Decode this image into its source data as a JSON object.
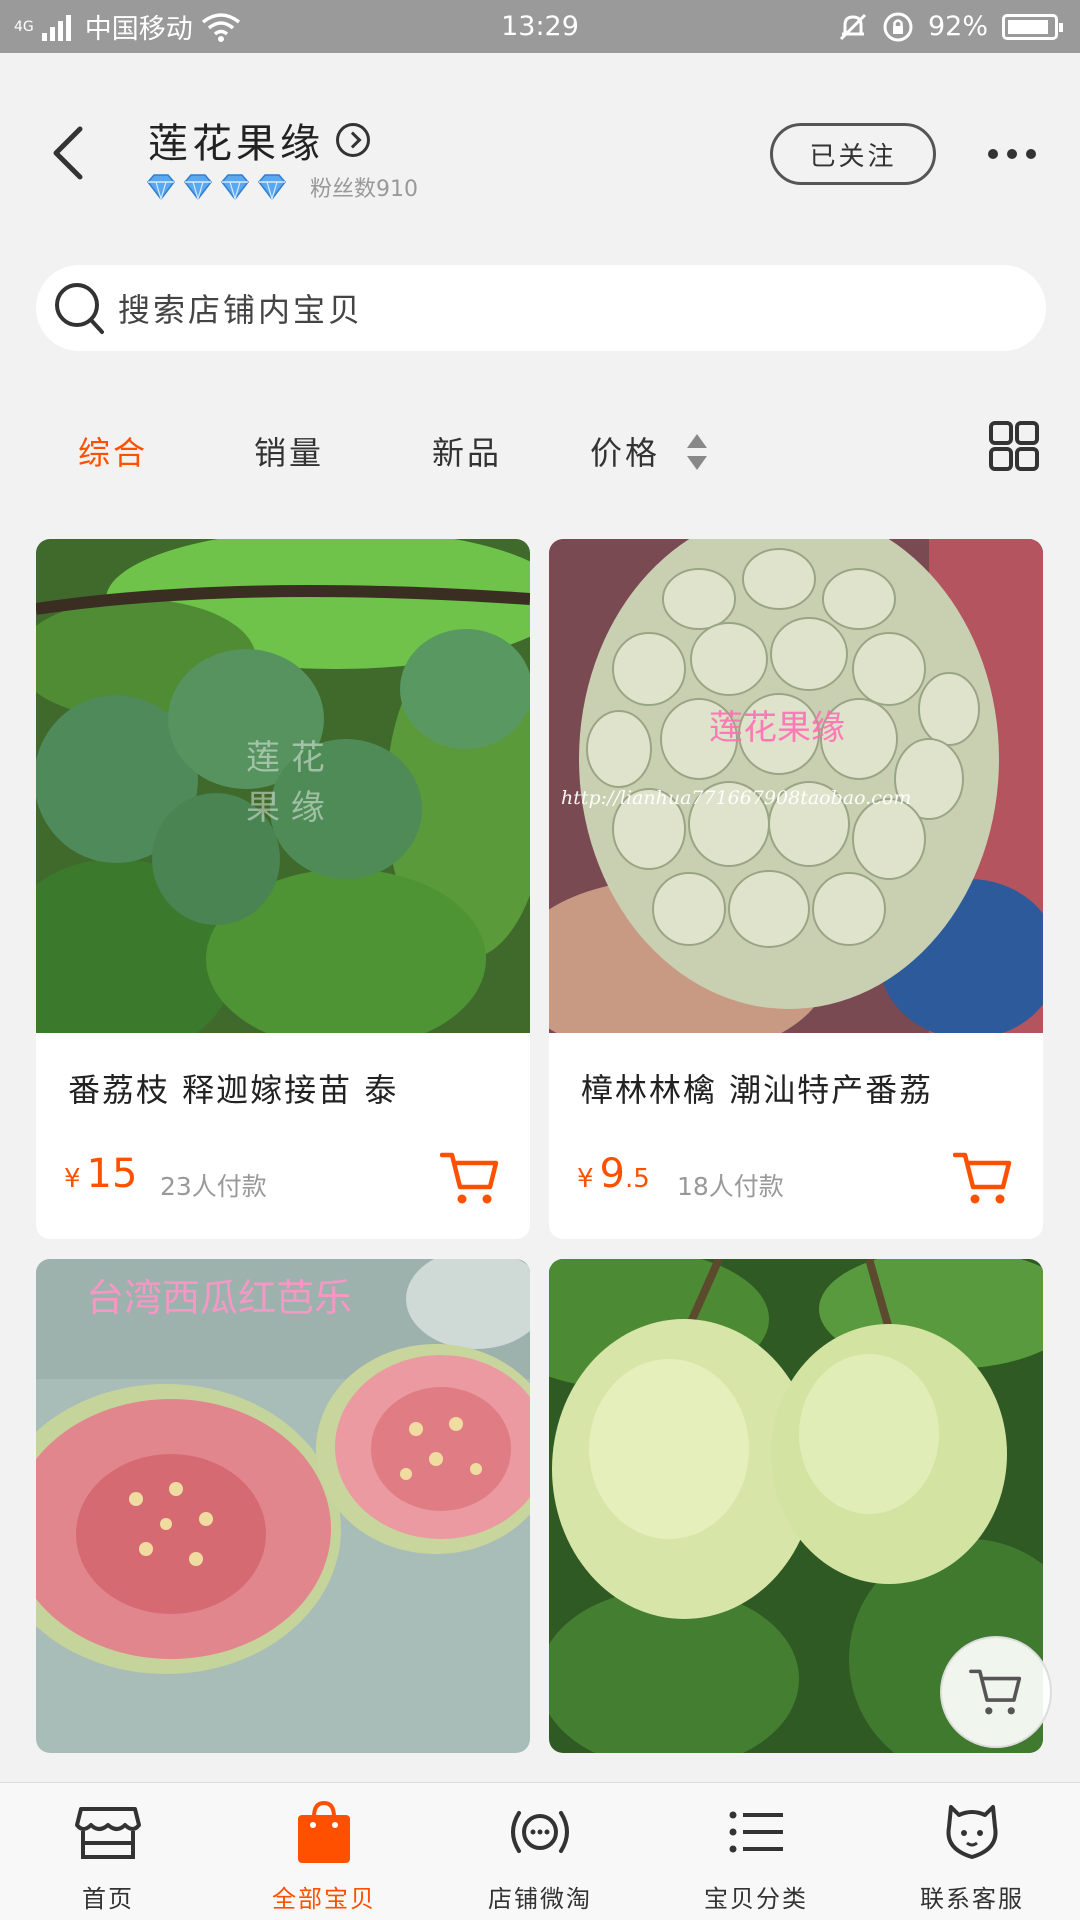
{
  "status_bar": {
    "network": "4G",
    "carrier": "中国移动",
    "time": "13:29",
    "battery": "92%",
    "battery_level": 0.92
  },
  "shop": {
    "name": "莲花果缘",
    "fans": "粉丝数910",
    "diamond_count": 4,
    "follow_label": "已关注"
  },
  "search": {
    "placeholder": "搜索店铺内宝贝"
  },
  "sort": {
    "items": [
      "综合",
      "销量",
      "新品",
      "价格"
    ],
    "active_index": 0
  },
  "products": [
    {
      "title": "番荔枝 释迦嫁接苗 泰",
      "currency": "¥",
      "price_int": "15",
      "price_dec": "",
      "sold": "23人付款"
    },
    {
      "title": "樟林林檎 潮汕特产番荔",
      "currency": "¥",
      "price_int": "9",
      "price_dec": ".5",
      "sold": "18人付款"
    },
    {
      "title": "",
      "currency": "",
      "price_int": "",
      "price_dec": "",
      "sold": ""
    },
    {
      "title": "",
      "currency": "",
      "price_int": "",
      "price_dec": "",
      "sold": ""
    }
  ],
  "watermarks": {
    "p2_shop": "莲花果缘",
    "p2_url": "http://lianhua771667908taobao.com",
    "p3_text": "台湾西瓜红芭乐"
  },
  "tabbar": {
    "items": [
      "首页",
      "全部宝贝",
      "店铺微淘",
      "宝贝分类",
      "联系客服"
    ],
    "active_index": 1
  },
  "colors": {
    "accent": "#ff5000",
    "status_bar_bg": "#9a9a9a",
    "page_bg": "#f2f2f2",
    "diamond": "#5aa9f0"
  }
}
